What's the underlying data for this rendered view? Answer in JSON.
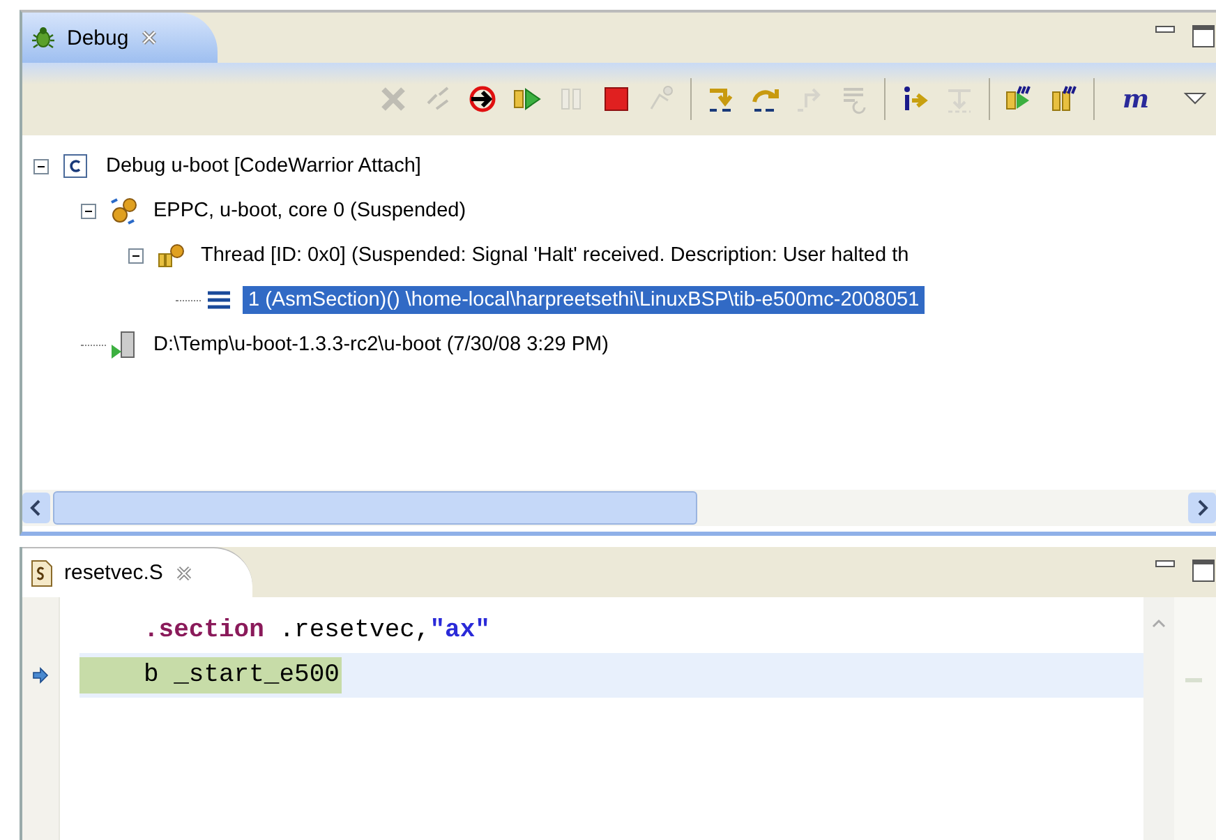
{
  "debug_view": {
    "tab": {
      "title": "Debug",
      "selected": true
    },
    "toolbar": [
      {
        "kind": "disconnect",
        "disabled": true
      },
      {
        "kind": "reconnect",
        "disabled": true
      },
      {
        "kind": "attach",
        "disabled": false
      },
      {
        "kind": "resume",
        "disabled": false
      },
      {
        "kind": "suspend",
        "disabled": true
      },
      {
        "kind": "terminate",
        "disabled": false
      },
      {
        "kind": "connect",
        "disabled": true
      },
      {
        "kind": "separator"
      },
      {
        "kind": "step-into",
        "disabled": false
      },
      {
        "kind": "step-over",
        "disabled": false
      },
      {
        "kind": "step-return",
        "disabled": true
      },
      {
        "kind": "drop-frame",
        "disabled": true
      },
      {
        "kind": "separator"
      },
      {
        "kind": "instruction-step",
        "disabled": false
      },
      {
        "kind": "use-step-filters",
        "disabled": true
      },
      {
        "kind": "separator"
      },
      {
        "kind": "resume-multi",
        "disabled": false
      },
      {
        "kind": "suspend-multi",
        "disabled": false
      },
      {
        "kind": "separator"
      },
      {
        "kind": "letter",
        "label": "m",
        "disabled": false
      },
      {
        "kind": "view-menu",
        "disabled": false
      }
    ],
    "tree": [
      {
        "kind": "launch",
        "label": "Debug u-boot [CodeWarrior Attach]",
        "expanded": true,
        "selected": false,
        "children": [
          {
            "kind": "target",
            "label": "EPPC, u-boot, core 0 (Suspended)",
            "expanded": true,
            "selected": false,
            "children": [
              {
                "kind": "thread",
                "label": "Thread [ID: 0x0] (Suspended: Signal 'Halt' received. Description: User halted th",
                "expanded": true,
                "selected": false,
                "children": [
                  {
                    "kind": "frame",
                    "label": "1 (AsmSection)() \\home-local\\harpreetsethi\\LinuxBSP\\tib-e500mc-2008051",
                    "selected": true
                  }
                ]
              }
            ]
          },
          {
            "kind": "process",
            "label": "D:\\Temp\\u-boot-1.3.3-rc2\\u-boot (7/30/08 3:29 PM)",
            "selected": false
          }
        ]
      }
    ]
  },
  "editor": {
    "tab": {
      "title": "resetvec.S",
      "selected": true
    },
    "lines": [
      {
        "current": false,
        "tokens": [
          {
            "kind": "directive",
            "text": ".section"
          },
          {
            "kind": "plain",
            "text": " .resetvec,"
          },
          {
            "kind": "string",
            "text": "\"ax\""
          }
        ]
      },
      {
        "current": true,
        "tokens": [
          {
            "kind": "plain",
            "text": "b _start_e500"
          }
        ]
      }
    ]
  }
}
